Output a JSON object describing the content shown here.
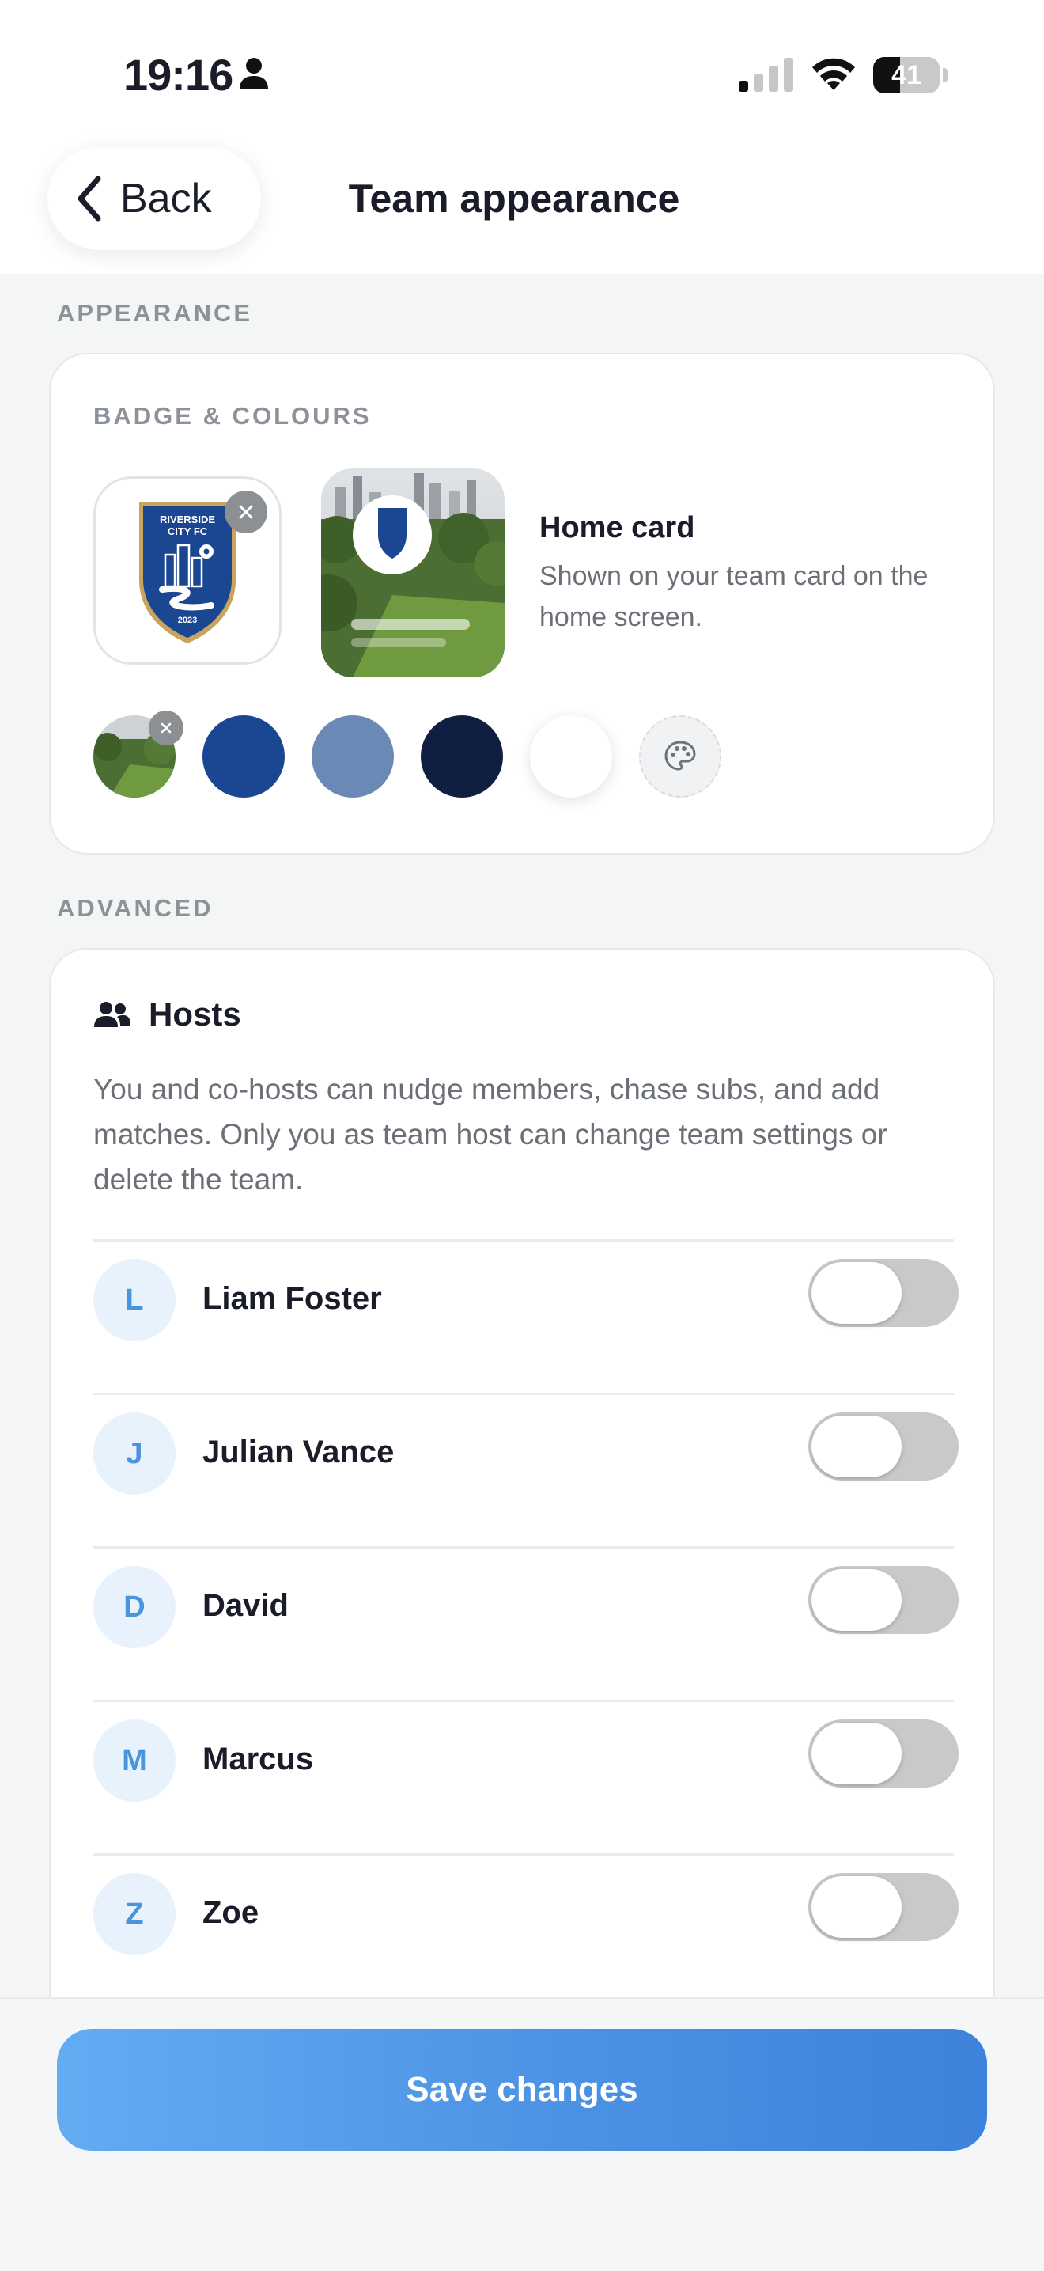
{
  "status_bar": {
    "time": "19:16",
    "battery": "41",
    "battery_level": 0.41
  },
  "header": {
    "back_label": "Back",
    "title": "Team appearance"
  },
  "appearance": {
    "section_label": "APPEARANCE",
    "badge_section_label": "BADGE & COLOURS",
    "badge": {
      "name": "RIVERSIDE CITY FC",
      "year": "2023"
    },
    "home_card": {
      "title": "Home card",
      "description": "Shown on your team card on the home screen."
    },
    "swatches": [
      {
        "name": "photo-background",
        "color": "#4f7a3a"
      },
      {
        "name": "royal-blue",
        "color": "#1b4692"
      },
      {
        "name": "slate-blue",
        "color": "#6a89b5"
      },
      {
        "name": "navy",
        "color": "#101e42"
      },
      {
        "name": "white",
        "color": "#ffffff"
      },
      {
        "name": "custom-colour",
        "color": "#f1f2f4"
      }
    ]
  },
  "advanced": {
    "section_label": "ADVANCED",
    "hosts": {
      "title": "Hosts",
      "description": "You and co-hosts can nudge members, chase subs, and add matches. Only you as team host can change team settings or delete the team.",
      "members": [
        {
          "initial": "L",
          "name": "Liam Foster",
          "co_host": false
        },
        {
          "initial": "J",
          "name": "Julian Vance",
          "co_host": false
        },
        {
          "initial": "D",
          "name": "David",
          "co_host": false
        },
        {
          "initial": "M",
          "name": "Marcus",
          "co_host": false
        },
        {
          "initial": "Z",
          "name": "Zoe",
          "co_host": false
        }
      ]
    }
  },
  "footer": {
    "save_label": "Save changes"
  },
  "colors": {
    "accent": "#4b92e4",
    "badge_blue": "#1b4692",
    "badge_gold": "#c9a45c"
  }
}
